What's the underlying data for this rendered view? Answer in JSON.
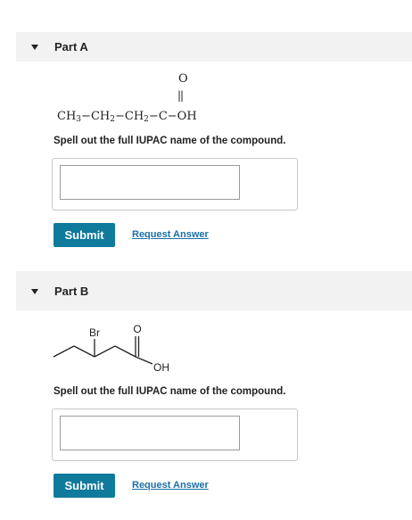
{
  "part_a": {
    "title": "Part A",
    "formula": {
      "oxygen": "O",
      "double_bond": "||",
      "ch3": "CH",
      "ch3_sub": "3",
      "ch2_1": "CH",
      "ch2_1_sub": "2",
      "ch2_2": "CH",
      "ch2_2_sub": "2",
      "c": "C",
      "oh": "OH",
      "bond": "−"
    },
    "prompt": "Spell out the full IUPAC name of the compound.",
    "input_value": "",
    "submit_label": "Submit",
    "request_label": "Request Answer"
  },
  "part_b": {
    "title": "Part B",
    "structure": {
      "br_label": "Br",
      "o_label": "O",
      "oh_label": "OH"
    },
    "prompt": "Spell out the full IUPAC name of the compound.",
    "input_value": "",
    "submit_label": "Submit",
    "request_label": "Request Answer"
  },
  "colors": {
    "submit_bg": "#0f7a9b",
    "link": "#1b6fa8",
    "header_bg": "#f2f2f2"
  },
  "icons": {
    "collapse": "caret-down-icon"
  }
}
